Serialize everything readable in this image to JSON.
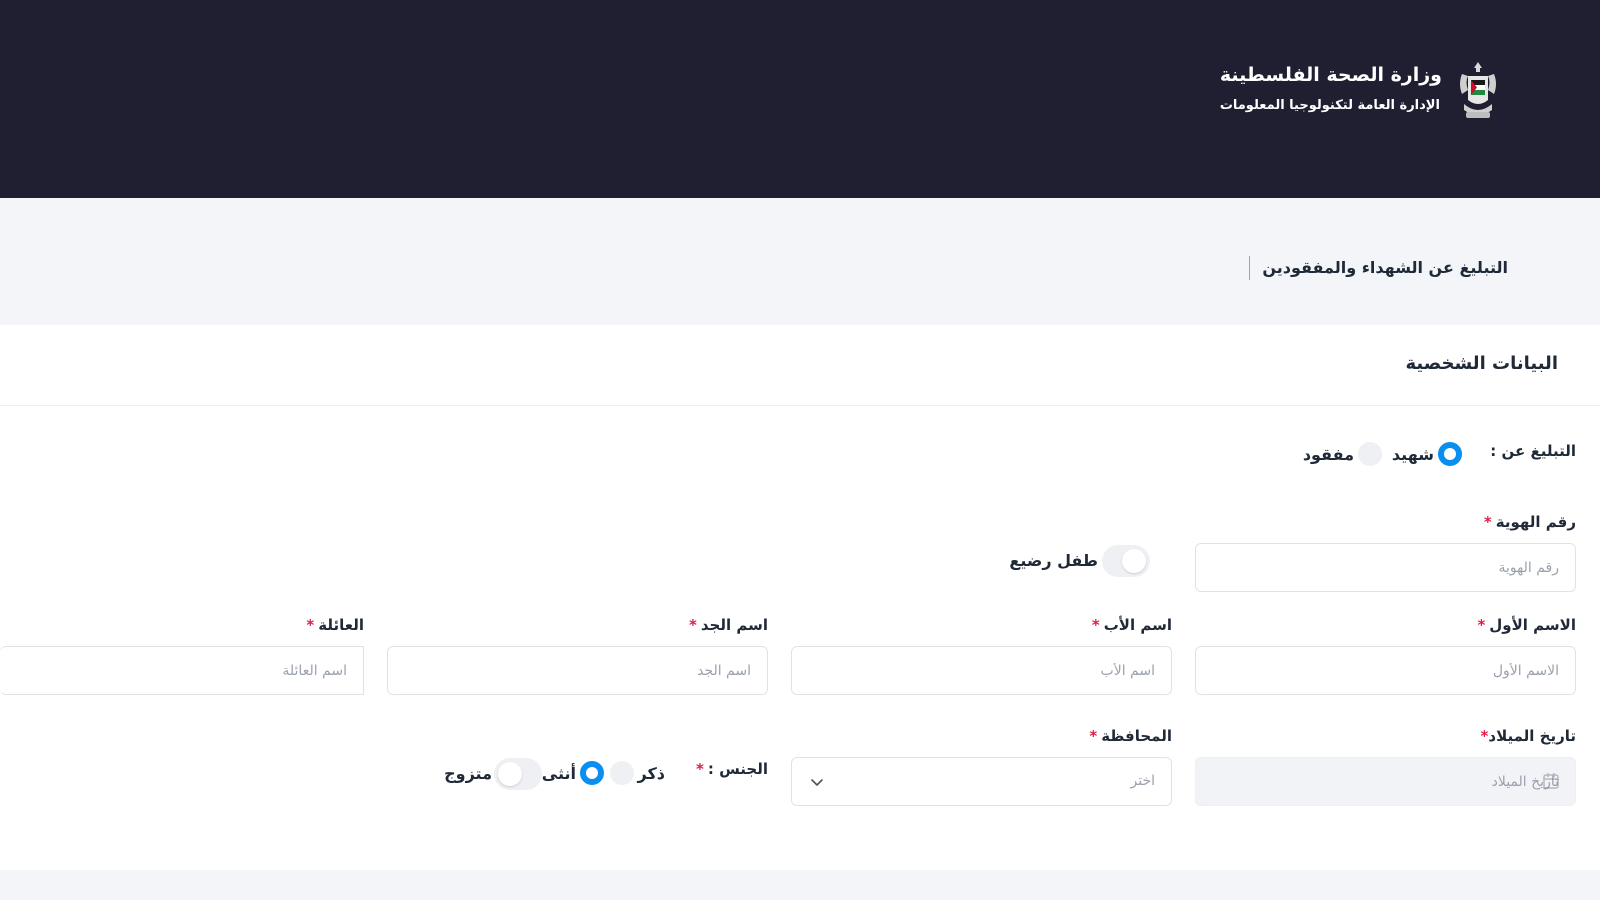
{
  "header": {
    "title": "وزارة الصحة الفلسطينة",
    "subtitle": "الإدارة العامة لتكنولوجيا المعلومات"
  },
  "page": {
    "title": "التبليغ عن الشهداء والمفقودين"
  },
  "section": {
    "title": "البيانات الشخصية"
  },
  "form": {
    "report_type": {
      "label": "التبليغ عن :",
      "options": [
        "شهيد",
        "مفقود"
      ],
      "selected": "شهيد"
    },
    "id_number": {
      "label": "رقم الهوية",
      "required_mark": "*",
      "placeholder": "رقم الهوية"
    },
    "infant": {
      "label": "طفل رضيع",
      "checked": false
    },
    "first_name": {
      "label": "الاسم الأول",
      "required_mark": "*",
      "placeholder": "الاسم الأول"
    },
    "father_name": {
      "label": "اسم الأب",
      "required_mark": "*",
      "placeholder": "اسم الأب"
    },
    "grandfather_name": {
      "label": "اسم الجد",
      "required_mark": "*",
      "placeholder": "اسم الجد"
    },
    "family_name": {
      "label": "العائلة",
      "required_mark": "*",
      "placeholder": "اسم العائلة"
    },
    "birth_date": {
      "label": "تاريخ الميلاد",
      "required_mark": "*",
      "placeholder": "تاريخ الميلاد"
    },
    "governorate": {
      "label": "المحافظة",
      "required_mark": "*",
      "value": "اختر"
    },
    "gender": {
      "label": "الجنس :",
      "required_mark": "*",
      "options": [
        "ذكر",
        "أنثى"
      ],
      "selected": "أنثى"
    },
    "married": {
      "label": "متزوج",
      "checked": false
    }
  },
  "colors": {
    "header_bg": "#1f1f31",
    "accent": "#0a8ff0",
    "required": "#e11d48"
  },
  "icons": {
    "emblem": "palestine-emblem-icon",
    "select": "chevron-down-icon",
    "date": "calendar-icon"
  }
}
